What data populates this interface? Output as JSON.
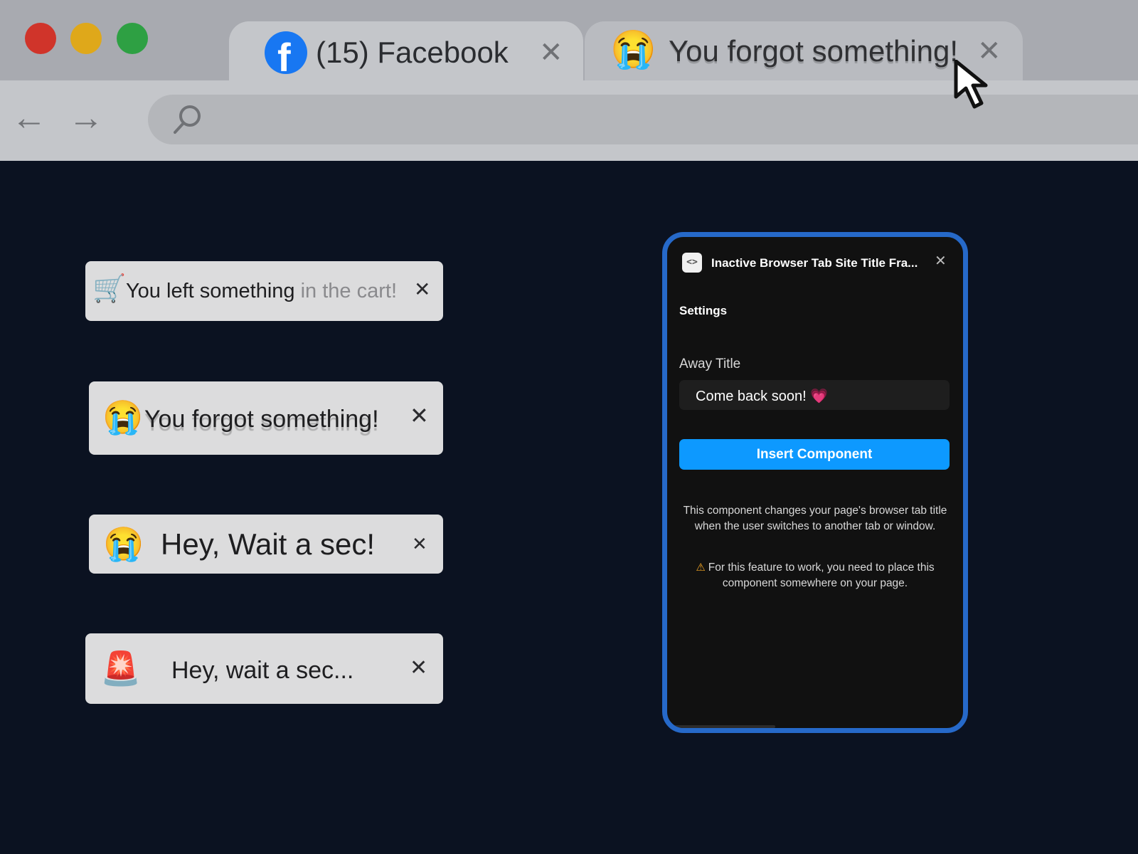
{
  "browser": {
    "tabs": [
      {
        "title": "(15) Facebook",
        "icon": "facebook-icon",
        "close": "✕"
      },
      {
        "title": "You forgot something!",
        "icon": "crying-face-emoji",
        "emoji": "😭",
        "close": "✕"
      }
    ],
    "nav": {
      "back": "←",
      "forward": "→"
    }
  },
  "tab_examples": [
    {
      "emoji": "🛒",
      "text_main": "You left something",
      "text_faded": "in the cart!",
      "close": "✕"
    },
    {
      "emoji": "😭",
      "text": "You forgot something!",
      "close": "✕"
    },
    {
      "emoji": "😭",
      "text": "Hey, Wait a sec!",
      "close": "✕"
    },
    {
      "emoji": "🚨",
      "text": "Hey, wait a sec...",
      "close": "✕"
    }
  ],
  "panel": {
    "icon_glyph": "<>",
    "title": "Inactive Browser Tab Site Title Fra...",
    "close": "✕",
    "settings_label": "Settings",
    "away_title_label": "Away Title",
    "away_title_value": "Come back soon! 💗",
    "insert_button": "Insert Component",
    "description": "This component changes your page's browser tab title when the user switches to another tab or window.",
    "warning_icon": "⚠",
    "warning": "For this feature to work, you need to place this component somewhere on your page."
  },
  "colors": {
    "background": "#0b1221",
    "panel_border": "#2669c9",
    "button_blue": "#0d99ff",
    "facebook_blue": "#1877f2"
  }
}
